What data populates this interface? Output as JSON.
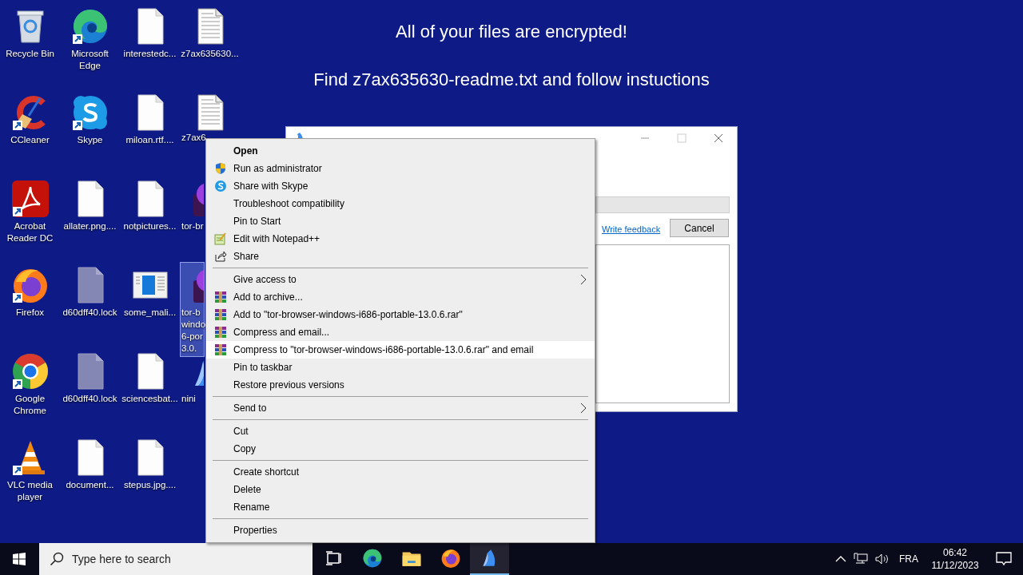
{
  "wallpaper_message": [
    "All of your files are encrypted!",
    "Find z7ax635630-readme.txt and follow instuctions"
  ],
  "desktop_icons": [
    {
      "label": "Recycle Bin",
      "kind": "recycle-bin",
      "shortcut": false,
      "selected": false,
      "label_cut": false,
      "icon_cut": false
    },
    {
      "label": "CCleaner",
      "kind": "broom",
      "shortcut": true,
      "selected": false,
      "label_cut": false,
      "icon_cut": false
    },
    {
      "label": "Acrobat\nReader DC",
      "kind": "pdf",
      "shortcut": true,
      "selected": false,
      "label_cut": false,
      "icon_cut": false
    },
    {
      "label": "Firefox",
      "kind": "fox",
      "shortcut": true,
      "selected": false,
      "label_cut": false,
      "icon_cut": false
    },
    {
      "label": "Google\nChrome",
      "kind": "ring",
      "shortcut": true,
      "selected": false,
      "label_cut": false,
      "icon_cut": false
    },
    {
      "label": "VLC media\nplayer",
      "kind": "cone",
      "shortcut": true,
      "selected": false,
      "label_cut": false,
      "icon_cut": false
    },
    {
      "label": "Microsoft\nEdge",
      "kind": "swirl",
      "shortcut": true,
      "selected": false,
      "label_cut": false,
      "icon_cut": false
    },
    {
      "label": "Skype",
      "kind": "bubble",
      "shortcut": true,
      "selected": false,
      "label_cut": false,
      "icon_cut": false
    },
    {
      "label": "allater.png....",
      "kind": "doc",
      "shortcut": false,
      "selected": false,
      "label_cut": false,
      "icon_cut": false
    },
    {
      "label": "d60dff40.lock",
      "kind": "lock",
      "shortcut": false,
      "selected": false,
      "label_cut": false,
      "icon_cut": false
    },
    {
      "label": "d60dff40.lock",
      "kind": "lock",
      "shortcut": false,
      "selected": false,
      "label_cut": false,
      "icon_cut": false
    },
    {
      "label": "document...",
      "kind": "doc",
      "shortcut": false,
      "selected": false,
      "label_cut": false,
      "icon_cut": false
    },
    {
      "label": "interestedc...",
      "kind": "doc",
      "shortcut": false,
      "selected": false,
      "label_cut": false,
      "icon_cut": false
    },
    {
      "label": "miloan.rtf....",
      "kind": "doc",
      "shortcut": false,
      "selected": false,
      "label_cut": false,
      "icon_cut": false
    },
    {
      "label": "notpictures...",
      "kind": "doc",
      "shortcut": false,
      "selected": false,
      "label_cut": false,
      "icon_cut": false
    },
    {
      "label": "some_mali...",
      "kind": "window",
      "shortcut": false,
      "selected": false,
      "label_cut": false,
      "icon_cut": false
    },
    {
      "label": "sciencesbat...",
      "kind": "doc",
      "shortcut": false,
      "selected": false,
      "label_cut": false,
      "icon_cut": false
    },
    {
      "label": "stepus.jpg....",
      "kind": "doc",
      "shortcut": false,
      "selected": false,
      "label_cut": false,
      "icon_cut": false
    },
    {
      "label": "z7ax635630...",
      "kind": "text-doc",
      "shortcut": false,
      "selected": false,
      "label_cut": false,
      "icon_cut": false
    },
    {
      "label": "z7ax6",
      "kind": "text-doc",
      "shortcut": false,
      "selected": false,
      "label_cut": true,
      "icon_cut": false
    },
    {
      "label": "tor-br",
      "kind": "orb",
      "shortcut": false,
      "selected": false,
      "label_cut": true,
      "icon_cut": true
    },
    {
      "label": "tor-b\nwindo\n6-por\n3.0.",
      "kind": "orb",
      "shortcut": false,
      "selected": true,
      "label_cut": true,
      "icon_cut": true
    },
    {
      "label": "nini",
      "kind": "sail",
      "shortcut": false,
      "selected": false,
      "label_cut": true,
      "icon_cut": true
    }
  ],
  "background_window": {
    "link": "Write feedback",
    "button": "Cancel"
  },
  "context_menu": {
    "groups": [
      [
        {
          "label": "Open",
          "kind": "default",
          "selected": false
        },
        {
          "label": "Run as administrator",
          "kind": "shield",
          "selected": false
        },
        {
          "label": "Share with Skype",
          "kind": "bubble",
          "selected": false
        },
        {
          "label": "Troubleshoot compatibility",
          "kind": "plain",
          "selected": false
        },
        {
          "label": "Pin to Start",
          "kind": "plain",
          "selected": false
        },
        {
          "label": "Edit with Notepad++",
          "kind": "notepad",
          "selected": false
        },
        {
          "label": "Share",
          "kind": "share",
          "selected": false
        }
      ],
      [
        {
          "label": "Give access to",
          "kind": "submenu",
          "selected": false
        },
        {
          "label": "Add to archive...",
          "kind": "archive",
          "selected": false
        },
        {
          "label": "Add to \"tor-browser-windows-i686-portable-13.0.6.rar\"",
          "kind": "archive",
          "selected": false
        },
        {
          "label": "Compress and email...",
          "kind": "archive",
          "selected": false
        },
        {
          "label": "Compress to \"tor-browser-windows-i686-portable-13.0.6.rar\" and email",
          "kind": "archive",
          "selected": true
        },
        {
          "label": "Pin to taskbar",
          "kind": "plain",
          "selected": false
        },
        {
          "label": "Restore previous versions",
          "kind": "plain",
          "selected": false
        }
      ],
      [
        {
          "label": "Send to",
          "kind": "submenu",
          "selected": false
        }
      ],
      [
        {
          "label": "Cut",
          "kind": "plain",
          "selected": false
        },
        {
          "label": "Copy",
          "kind": "plain",
          "selected": false
        }
      ],
      [
        {
          "label": "Create shortcut",
          "kind": "plain",
          "selected": false
        },
        {
          "label": "Delete",
          "kind": "plain",
          "selected": false
        },
        {
          "label": "Rename",
          "kind": "plain",
          "selected": false
        }
      ],
      [
        {
          "label": "Properties",
          "kind": "plain",
          "selected": false
        }
      ]
    ]
  },
  "taskbar": {
    "search_placeholder": "Type here to search",
    "apps": [
      {
        "kind": "task-view",
        "active": false
      },
      {
        "kind": "swirl",
        "active": false
      },
      {
        "kind": "folder",
        "active": false
      },
      {
        "kind": "fox",
        "active": false
      },
      {
        "kind": "sail",
        "active": true
      }
    ],
    "language": "FRA",
    "time": "06:42",
    "date": "11/12/2023"
  }
}
